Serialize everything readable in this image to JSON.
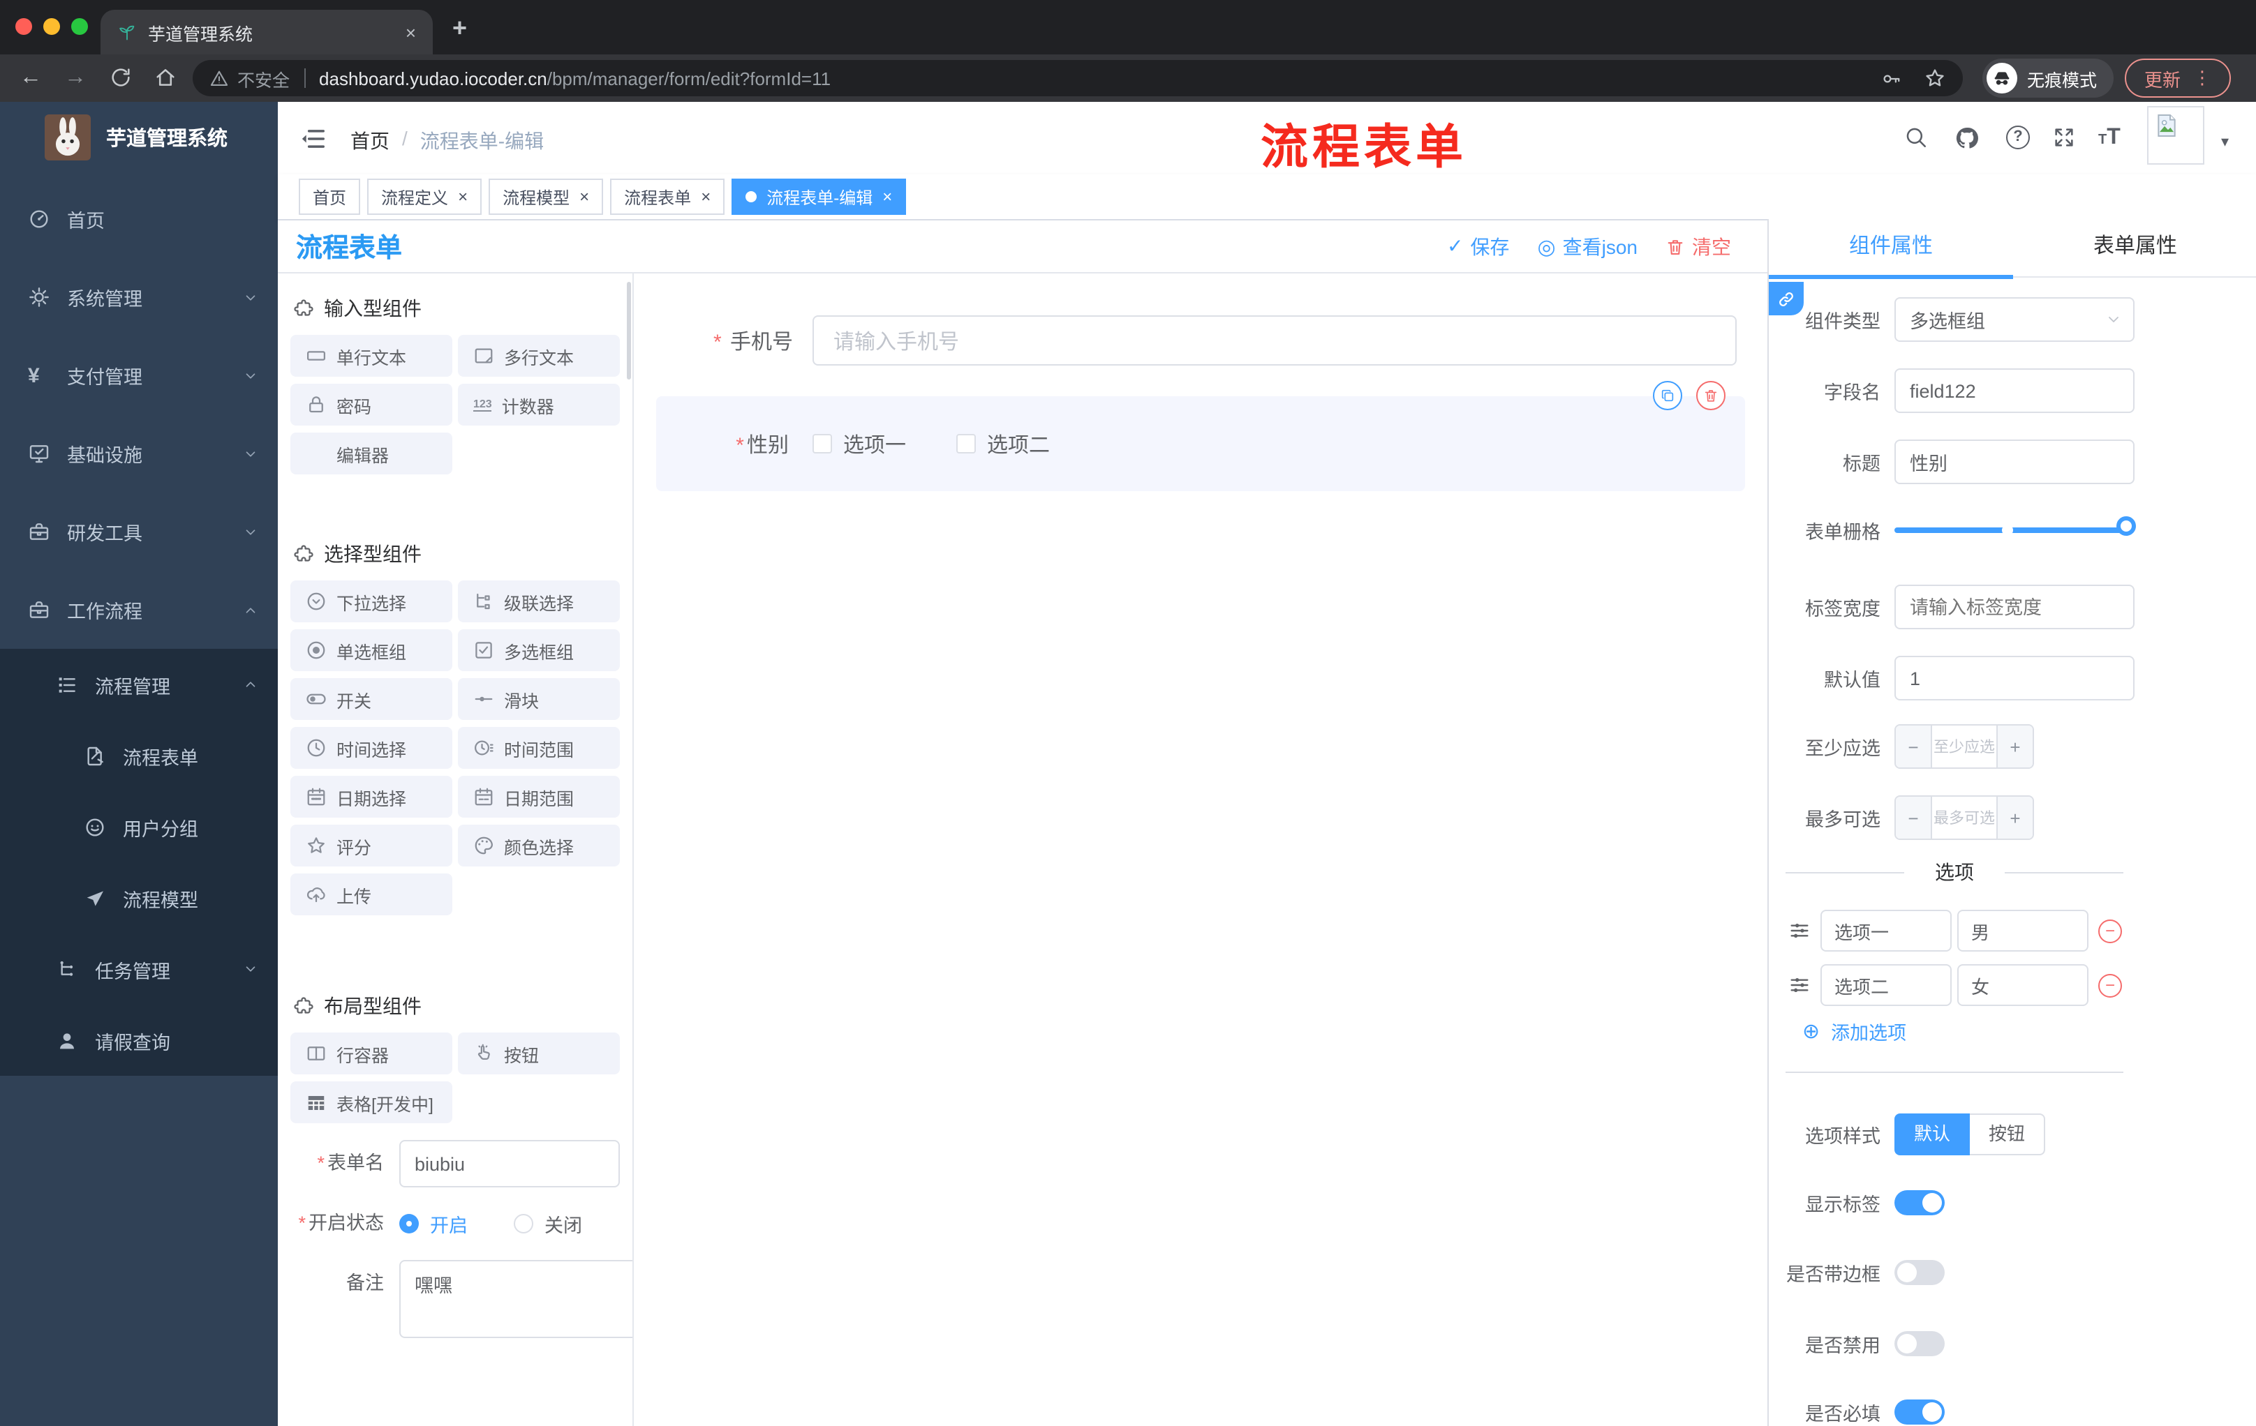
{
  "icons": {
    "check": "✓",
    "view": "◎",
    "caret": "▾",
    "kebab": "⋮",
    "close": "×",
    "plus": "+",
    "back": "←",
    "forward": "→",
    "question": "?",
    "minus": "−",
    "plus_small": "+",
    "add_circle": "⊕",
    "asterisk": "*",
    "slash": "/",
    "dot": "●",
    "counter": "123",
    "font_resize": "T"
  },
  "browser": {
    "tab_title": "芋道管理系统",
    "security_label": "不安全",
    "url_domain": "dashboard.yudao.iocoder.cn",
    "url_path": "/bpm/manager/form/edit?formId=11",
    "incognito_label": "无痕模式",
    "update_label": "更新"
  },
  "sidebar": {
    "brand": "芋道管理系统",
    "items": [
      {
        "label": "首页",
        "icon": "dashboard-icon"
      },
      {
        "label": "系统管理",
        "icon": "gear-icon"
      },
      {
        "label": "支付管理",
        "icon": "yen-icon"
      },
      {
        "label": "基础设施",
        "icon": "monitor-icon"
      },
      {
        "label": "研发工具",
        "icon": "toolbox-icon"
      },
      {
        "label": "工作流程",
        "icon": "briefcase-icon"
      }
    ],
    "groups": [
      {
        "label": "流程管理",
        "icon": "flow-list-icon",
        "children": [
          {
            "label": "流程表单",
            "icon": "form-doc-icon"
          },
          {
            "label": "用户分组",
            "icon": "user-group-icon"
          },
          {
            "label": "流程模型",
            "icon": "paper-plane-icon"
          }
        ]
      },
      {
        "label": "任务管理",
        "icon": "task-tree-icon"
      },
      {
        "label": "请假查询",
        "icon": "person-icon"
      }
    ]
  },
  "header": {
    "breadcrumb": [
      "首页",
      "流程表单-编辑"
    ],
    "annotation": "流程表单"
  },
  "tags": [
    {
      "label": "首页",
      "active": false,
      "closable": false
    },
    {
      "label": "流程定义",
      "active": false,
      "closable": true
    },
    {
      "label": "流程模型",
      "active": false,
      "closable": true
    },
    {
      "label": "流程表单",
      "active": false,
      "closable": true
    },
    {
      "label": "流程表单-编辑",
      "active": true,
      "closable": true
    }
  ],
  "designer": {
    "title": "流程表单",
    "toolbar": {
      "save": "保存",
      "view_json": "查看json",
      "clear": "清空"
    }
  },
  "palette": {
    "sections": [
      {
        "title": "输入型组件",
        "items": [
          {
            "label": "单行文本"
          },
          {
            "label": "多行文本"
          },
          {
            "label": "密码"
          },
          {
            "label": "计数器"
          },
          {
            "label": "编辑器"
          }
        ]
      },
      {
        "title": "选择型组件",
        "items": [
          {
            "label": "下拉选择"
          },
          {
            "label": "级联选择"
          },
          {
            "label": "单选框组"
          },
          {
            "label": "多选框组"
          },
          {
            "label": "开关"
          },
          {
            "label": "滑块"
          },
          {
            "label": "时间选择"
          },
          {
            "label": "时间范围"
          },
          {
            "label": "日期选择"
          },
          {
            "label": "日期范围"
          },
          {
            "label": "评分"
          },
          {
            "label": "颜色选择"
          },
          {
            "label": "上传"
          }
        ]
      },
      {
        "title": "布局型组件",
        "items": [
          {
            "label": "行容器"
          },
          {
            "label": "按钮"
          },
          {
            "label": "表格[开发中]"
          }
        ]
      }
    ]
  },
  "form_meta": {
    "name_label": "表单名",
    "name_value": "biubiu",
    "status_label": "开启状态",
    "status_on": "开启",
    "status_off": "关闭",
    "remark_label": "备注",
    "remark_value": "嘿嘿"
  },
  "canvas": {
    "phone": {
      "label": "手机号",
      "placeholder": "请输入手机号"
    },
    "gender": {
      "label": "性别",
      "options": [
        "选项一",
        "选项二"
      ]
    }
  },
  "props": {
    "tab_component": "组件属性",
    "tab_form": "表单属性",
    "type_label": "组件类型",
    "type_value": "多选框组",
    "field_label": "字段名",
    "field_value": "field122",
    "title_label": "标题",
    "title_value": "性别",
    "grid_label": "表单栅格",
    "width_label": "标签宽度",
    "width_placeholder": "请输入标签宽度",
    "default_label": "默认值",
    "default_value": "1",
    "min_label": "至少应选",
    "min_placeholder": "至少应选",
    "max_label": "最多可选",
    "max_placeholder": "最多可选",
    "options_title": "选项",
    "options": [
      {
        "name": "选项一",
        "value": "男"
      },
      {
        "name": "选项二",
        "value": "女"
      }
    ],
    "add_option": "添加选项",
    "style_label": "选项样式",
    "style_default": "默认",
    "style_button": "按钮",
    "toggles": [
      {
        "label": "显示标签",
        "on": true
      },
      {
        "label": "是否带边框",
        "on": false
      },
      {
        "label": "是否禁用",
        "on": false
      },
      {
        "label": "是否必填",
        "on": true
      }
    ]
  }
}
